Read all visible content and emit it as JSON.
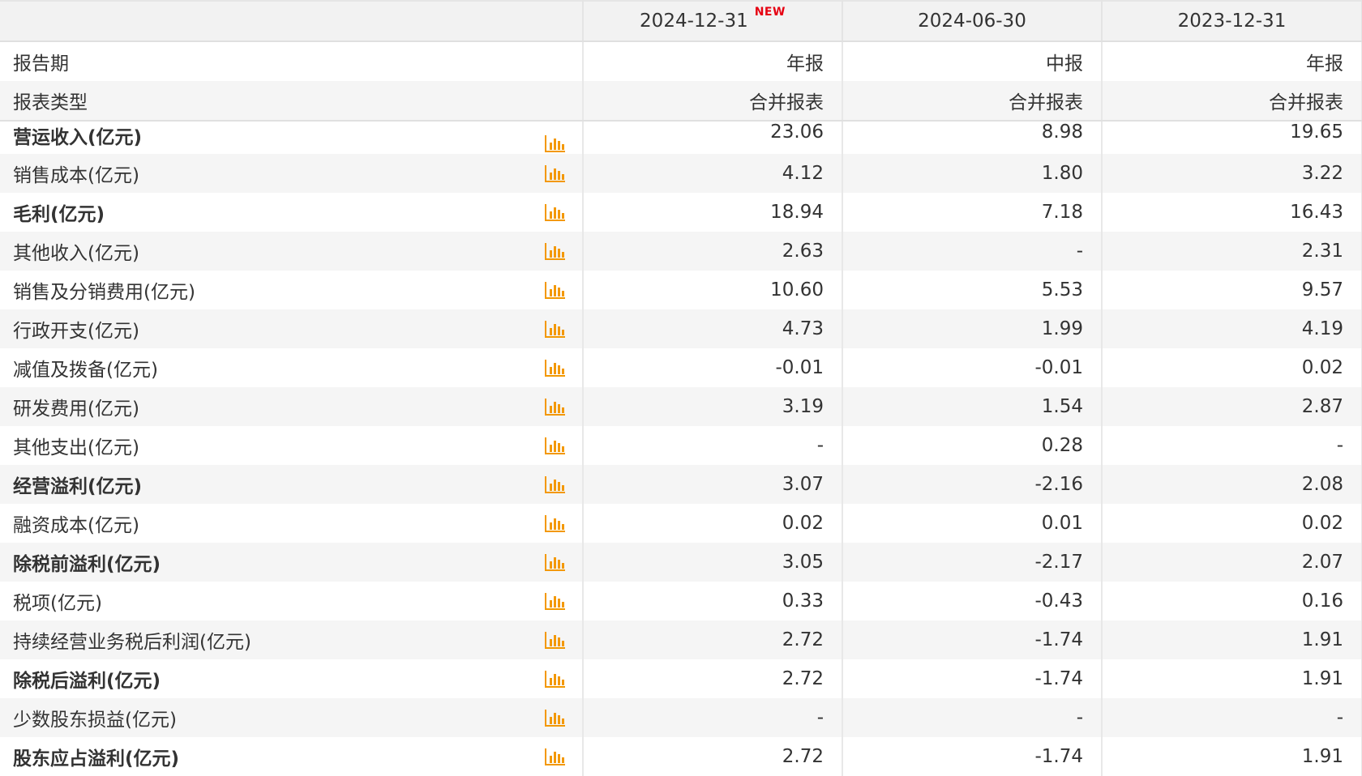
{
  "header": {
    "columns": [
      "2024-12-31",
      "2024-06-30",
      "2023-12-31"
    ],
    "new_badge": "NEW"
  },
  "meta_rows": [
    {
      "label": "报告期",
      "values": [
        "年报",
        "中报",
        "年报"
      ]
    },
    {
      "label": "报表类型",
      "values": [
        "合并报表",
        "合并报表",
        "合并报表"
      ]
    }
  ],
  "icons": {
    "chart": "bar-chart-icon",
    "accent": "#f39800"
  },
  "rows": [
    {
      "label": "营运收入(亿元)",
      "bold": true,
      "values": [
        "23.06",
        "8.98",
        "19.65"
      ]
    },
    {
      "label": "销售成本(亿元)",
      "bold": false,
      "values": [
        "4.12",
        "1.80",
        "3.22"
      ]
    },
    {
      "label": "毛利(亿元)",
      "bold": true,
      "values": [
        "18.94",
        "7.18",
        "16.43"
      ]
    },
    {
      "label": "其他收入(亿元)",
      "bold": false,
      "values": [
        "2.63",
        "-",
        "2.31"
      ]
    },
    {
      "label": "销售及分销费用(亿元)",
      "bold": false,
      "values": [
        "10.60",
        "5.53",
        "9.57"
      ]
    },
    {
      "label": "行政开支(亿元)",
      "bold": false,
      "values": [
        "4.73",
        "1.99",
        "4.19"
      ]
    },
    {
      "label": "减值及拨备(亿元)",
      "bold": false,
      "values": [
        "-0.01",
        "-0.01",
        "0.02"
      ]
    },
    {
      "label": "研发费用(亿元)",
      "bold": false,
      "values": [
        "3.19",
        "1.54",
        "2.87"
      ]
    },
    {
      "label": "其他支出(亿元)",
      "bold": false,
      "values": [
        "-",
        "0.28",
        "-"
      ]
    },
    {
      "label": "经营溢利(亿元)",
      "bold": true,
      "values": [
        "3.07",
        "-2.16",
        "2.08"
      ]
    },
    {
      "label": "融资成本(亿元)",
      "bold": false,
      "values": [
        "0.02",
        "0.01",
        "0.02"
      ]
    },
    {
      "label": "除税前溢利(亿元)",
      "bold": true,
      "values": [
        "3.05",
        "-2.17",
        "2.07"
      ]
    },
    {
      "label": "税项(亿元)",
      "bold": false,
      "values": [
        "0.33",
        "-0.43",
        "0.16"
      ]
    },
    {
      "label": "持续经营业务税后利润(亿元)",
      "bold": false,
      "values": [
        "2.72",
        "-1.74",
        "1.91"
      ]
    },
    {
      "label": "除税后溢利(亿元)",
      "bold": true,
      "values": [
        "2.72",
        "-1.74",
        "1.91"
      ]
    },
    {
      "label": "少数股东损益(亿元)",
      "bold": false,
      "values": [
        "-",
        "-",
        "-"
      ]
    },
    {
      "label": "股东应占溢利(亿元)",
      "bold": true,
      "values": [
        "2.72",
        "-1.74",
        "1.91"
      ]
    }
  ]
}
